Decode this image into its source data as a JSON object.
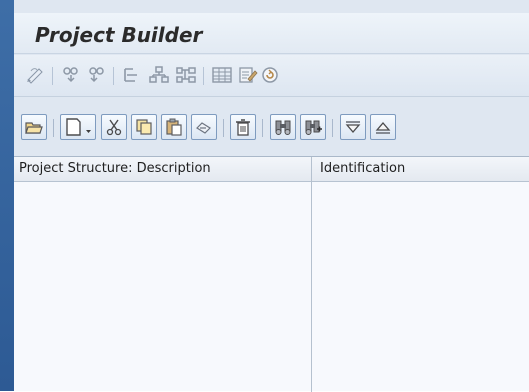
{
  "window": {
    "title": "Project Builder"
  },
  "app_toolbar": {
    "icons": [
      "edit-pencil-icon",
      "move-left-icon",
      "move-right-icon",
      "hierarchy-list-icon",
      "structure-tree-icon",
      "network-graph-icon",
      "table-grid-icon",
      "edit-document-icon",
      "refresh-circle-icon"
    ]
  },
  "tree_toolbar": {
    "buttons": [
      "open-folder-icon",
      "new-document-icon",
      "cut-icon",
      "copy-icon",
      "paste-icon",
      "undo-icon",
      "delete-icon",
      "find-icon",
      "find-next-icon",
      "expand-icon",
      "collapse-icon"
    ]
  },
  "grid": {
    "columns": [
      {
        "label": "Project Structure: Description"
      },
      {
        "label": "Identification"
      }
    ],
    "rows": []
  },
  "colors": {
    "frame_edge": "#2d5a94",
    "background": "#dfe7f1",
    "grid_background": "#f7f9fd",
    "button_border": "#7e9bbf"
  }
}
